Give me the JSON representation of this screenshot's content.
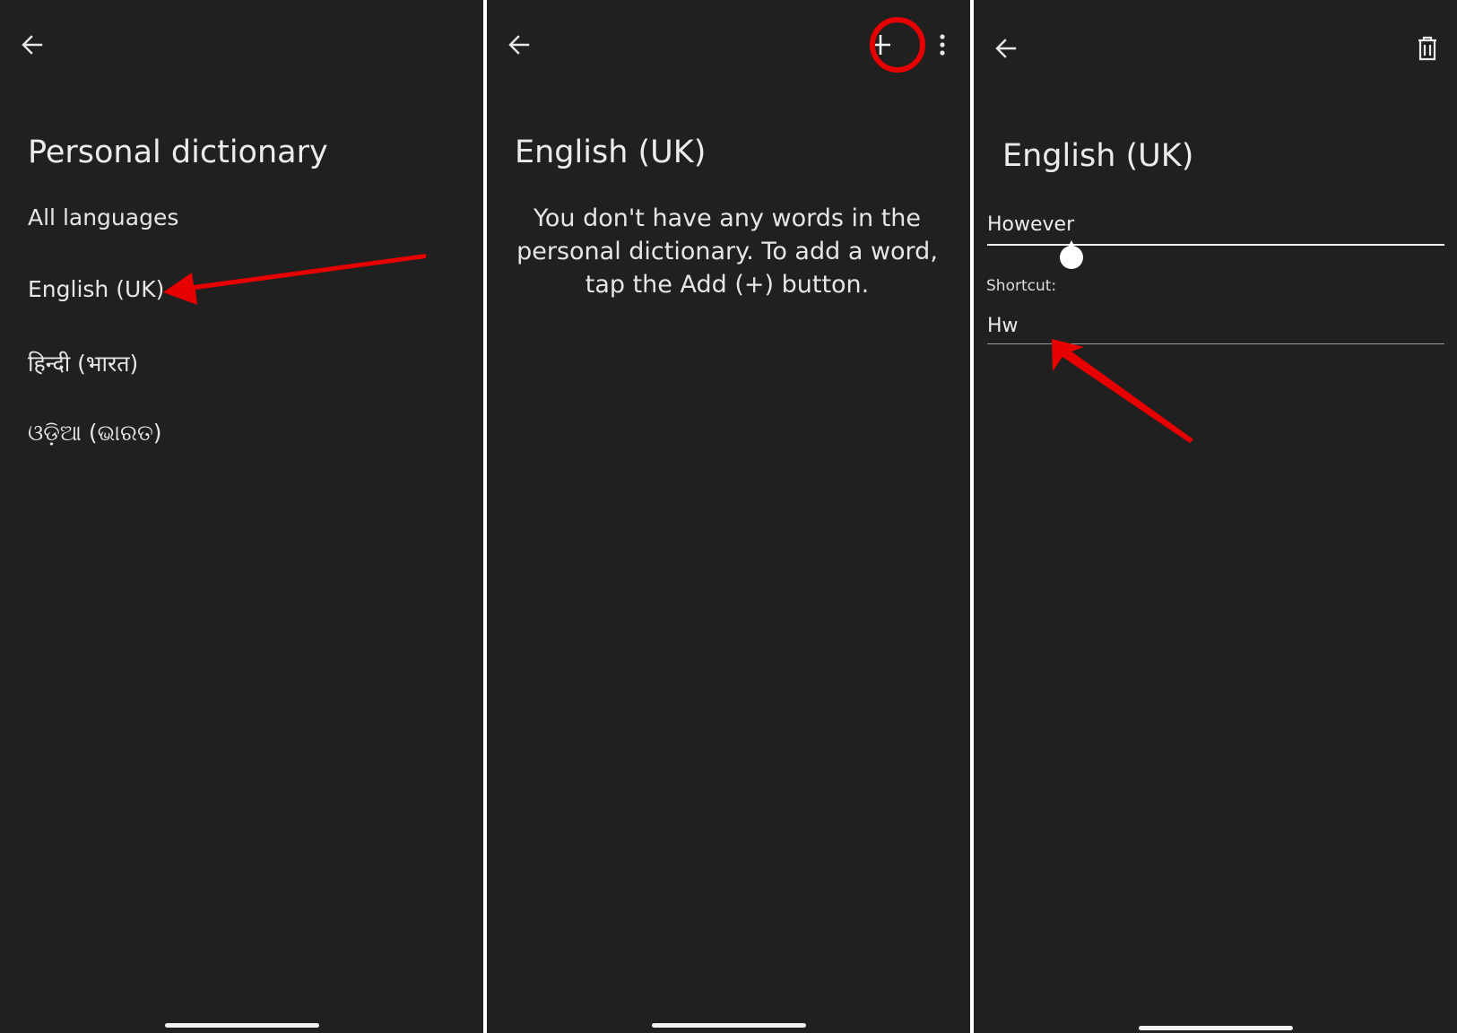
{
  "panel1": {
    "title": "Personal dictionary",
    "languages": [
      {
        "label": "All languages"
      },
      {
        "label": "English (UK)"
      },
      {
        "label": "हिन्दी (भारत)"
      },
      {
        "label": "ଓଡ଼ିଆ (ଭାରତ)"
      }
    ]
  },
  "panel2": {
    "title": "English (UK)",
    "empty_message": "You don't have any words in the personal dictionary. To add a word, tap the Add (+) button."
  },
  "panel3": {
    "title": "English (UK)",
    "word": "However",
    "shortcut_label": "Shortcut:",
    "shortcut": "Hw"
  },
  "colors": {
    "background": "#202020",
    "text": "#ececec",
    "annotation": "#e60000"
  },
  "icons": [
    "back-arrow-icon",
    "plus-icon",
    "more-vert-icon",
    "trash-icon"
  ]
}
